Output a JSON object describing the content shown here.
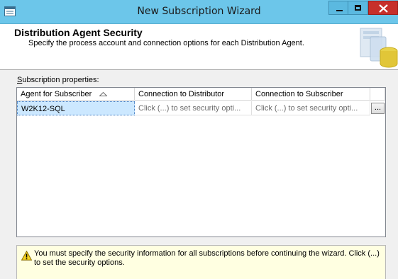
{
  "window": {
    "title": "New Subscription Wizard",
    "controls": {
      "minimize": "minimize",
      "maximize": "maximize",
      "close": "close"
    }
  },
  "header": {
    "title": "Distribution Agent Security",
    "subtitle": "Specify the process account and connection options for each Distribution Agent."
  },
  "subscription_properties": {
    "label_accesskey": "S",
    "label_rest": "ubscription properties:",
    "columns": [
      "Agent for Subscriber",
      "Connection to Distributor",
      "Connection to Subscriber",
      ""
    ],
    "rows": [
      {
        "agent": "W2K12-SQL",
        "distributor": "Click (...) to set security opti...",
        "subscriber": "Click (...) to set security opti...",
        "button": "..."
      }
    ]
  },
  "warning": {
    "icon": "warning-icon",
    "text": "You must specify the security information for all subscriptions before continuing the wizard. Click (...) to set the security options."
  },
  "colors": {
    "titlebar": "#6cc6ea",
    "close_button": "#c7302b",
    "selection": "#cce8ff",
    "warning_bg": "#ffffe1"
  }
}
